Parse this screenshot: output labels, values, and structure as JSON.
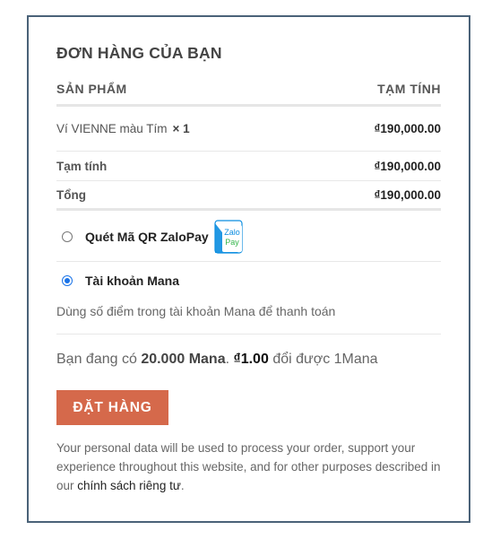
{
  "checkout": {
    "title": "ĐƠN HÀNG CỦA BẠN",
    "col_product": "SẢN PHẨM",
    "col_subtotal": "TẠM TÍNH",
    "item": {
      "name": "Ví VIENNE màu Tím",
      "qty": "× 1",
      "price": "₫190,000.00"
    },
    "subtotal": {
      "label": "Tạm tính",
      "value": "₫190,000.00"
    },
    "total": {
      "label": "Tổng",
      "value": "₫190,000.00"
    }
  },
  "payment": {
    "methods": [
      {
        "label": "Quét Mã QR ZaloPay",
        "selected": false,
        "logo_top": "Zalo",
        "logo_bottom": "Pay"
      },
      {
        "label": "Tài khoản Mana",
        "selected": true
      }
    ],
    "mana_desc": "Dùng số điểm trong tài khoản Mana để thanh toán",
    "balance": {
      "prefix": "Bạn đang có",
      "amount": "20.000 Mana",
      "sep": ".",
      "rate": "₫1.00",
      "suffix": "đổi được 1Mana"
    }
  },
  "order_button": "ĐẶT HÀNG",
  "privacy": {
    "text": "Your personal data will be used to process your order, support your experience throughout this website, and for other purposes described in our ",
    "link": "chính sách riêng tư",
    "end": "."
  },
  "colors": {
    "border": "#4a6278",
    "button": "#d5694b",
    "radio": "#1a73e8",
    "zalo_blue": "#0a8de0",
    "zalo_green": "#34b54a"
  }
}
